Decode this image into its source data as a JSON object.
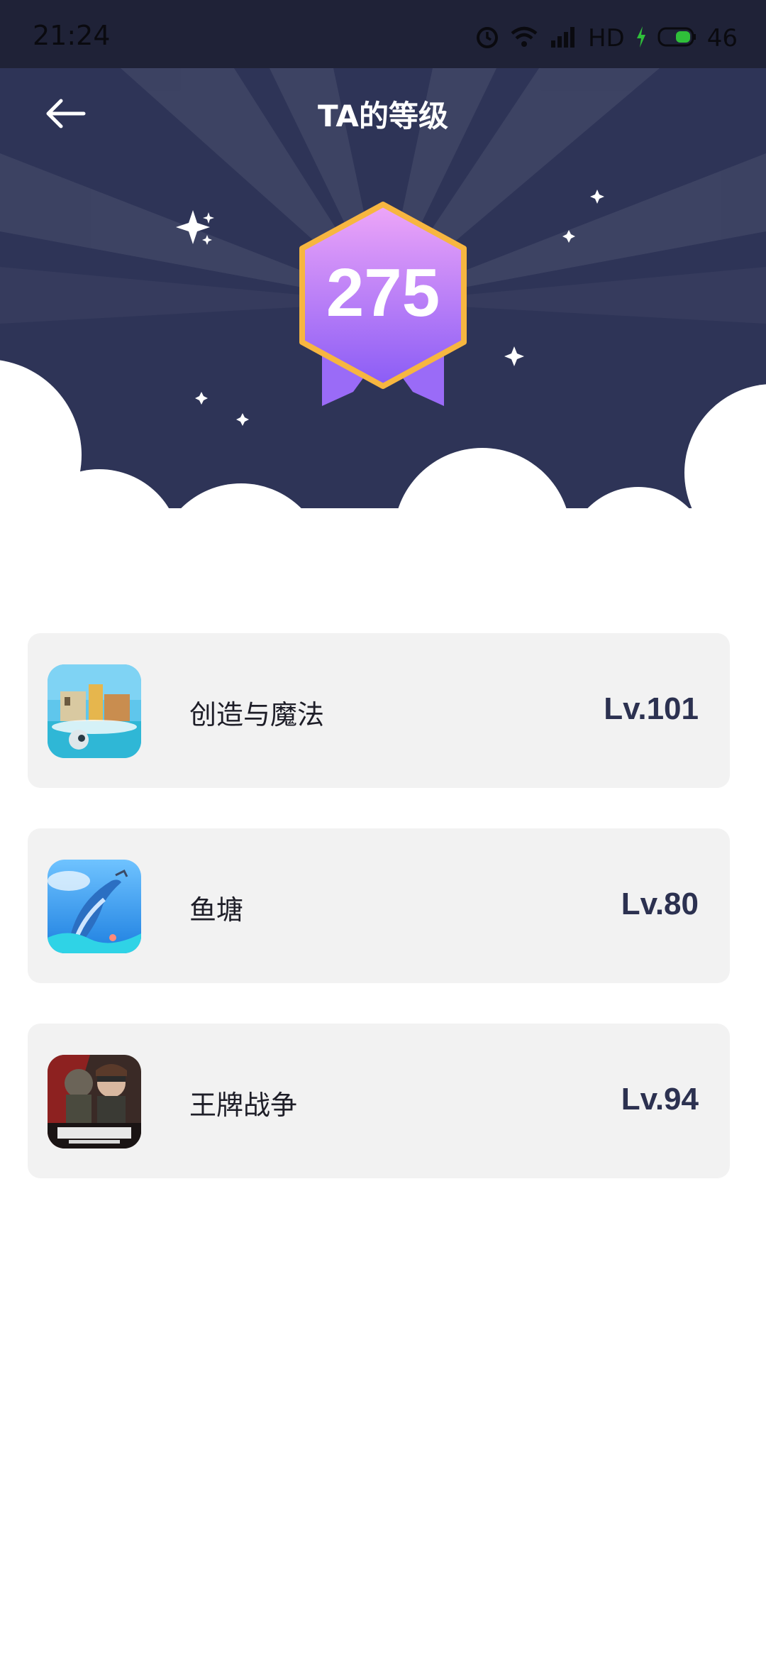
{
  "status_bar": {
    "time": "21:24",
    "network": "HD",
    "battery": "46",
    "icons": [
      "alarm-icon",
      "wifi-icon",
      "signal-4g-icon",
      "charging-icon",
      "battery-icon"
    ]
  },
  "header": {
    "title": "TA的等级",
    "back_icon": "arrow-left-icon"
  },
  "badge": {
    "level": "275"
  },
  "games": [
    {
      "name": "创造与魔法",
      "level": "Lv.101"
    },
    {
      "name": "鱼塘",
      "level": "Lv.80"
    },
    {
      "name": "王牌战争",
      "level": "Lv.94"
    }
  ],
  "colors": {
    "header_bg": "#2e3457",
    "badge_top": "#eea6f8",
    "badge_bottom": "#8a5cf6",
    "badge_border": "#f7b640",
    "card_bg": "#f2f2f2",
    "level_text": "#2c3150"
  }
}
